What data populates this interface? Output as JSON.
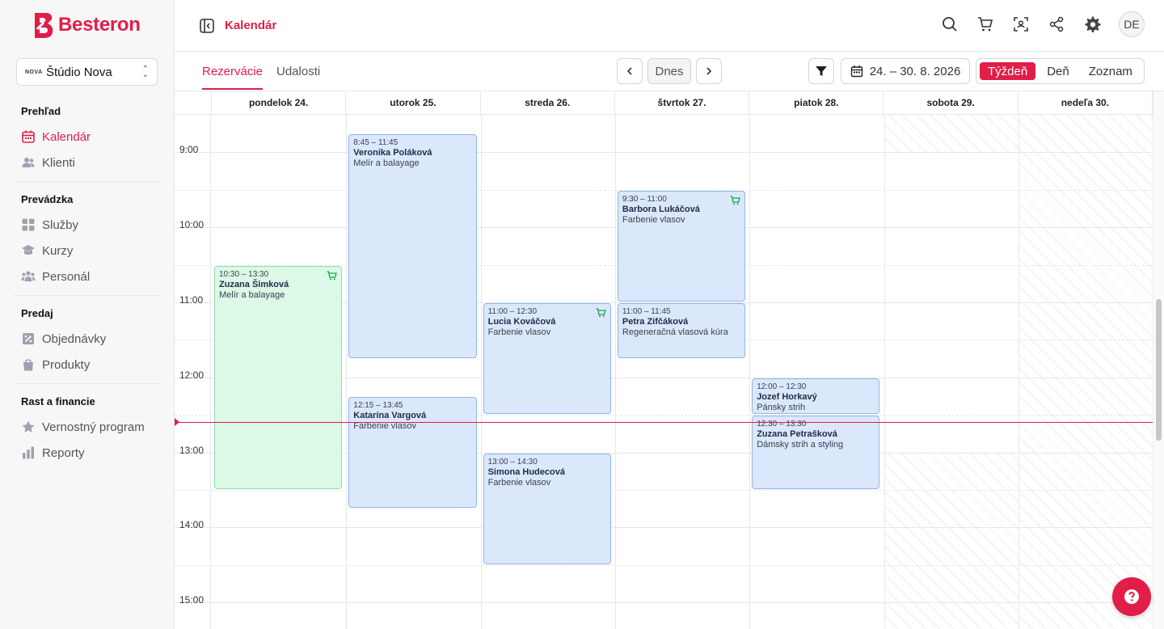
{
  "brand": {
    "name": "Besteron",
    "color": "#e11d48"
  },
  "studio": {
    "logo_text": "NOVA",
    "name": "Štúdio Nova"
  },
  "nav": {
    "groups": [
      {
        "title": "Prehľad",
        "items": [
          {
            "label": "Kalendár",
            "icon": "calendar-icon",
            "active": true
          },
          {
            "label": "Klienti",
            "icon": "users-icon"
          }
        ]
      },
      {
        "title": "Prevádzka",
        "items": [
          {
            "label": "Služby",
            "icon": "grid-icon"
          },
          {
            "label": "Kurzy",
            "icon": "graduation-cap-icon"
          },
          {
            "label": "Personál",
            "icon": "team-icon"
          }
        ]
      },
      {
        "title": "Predaj",
        "items": [
          {
            "label": "Objednávky",
            "icon": "percent-icon"
          },
          {
            "label": "Produkty",
            "icon": "bag-icon"
          }
        ]
      },
      {
        "title": "Rast a financie",
        "items": [
          {
            "label": "Vernostný program",
            "icon": "star-icon"
          },
          {
            "label": "Reporty",
            "icon": "bar-chart-icon"
          }
        ]
      }
    ]
  },
  "header": {
    "title": "Kalendár",
    "avatar": "DE"
  },
  "toolbar": {
    "tabs": [
      {
        "label": "Rezervácie",
        "active": true
      },
      {
        "label": "Udalosti"
      }
    ],
    "today_label": "Dnes",
    "date_range": "24. – 30. 8. 2026",
    "views": [
      {
        "label": "Týždeň",
        "active": true
      },
      {
        "label": "Deň"
      },
      {
        "label": "Zoznam"
      }
    ]
  },
  "calendar": {
    "days": [
      "pondelok 24.",
      "utorok 25.",
      "streda 26.",
      "štvrtok 27.",
      "piatok 28.",
      "sobota 29.",
      "nedeľa 30."
    ],
    "hours": [
      "9:00",
      "10:00",
      "11:00",
      "12:00",
      "13:00",
      "14:00",
      "15:00"
    ],
    "now_time": "12:36",
    "events": [
      {
        "day": 0,
        "start": "10:30",
        "end": "13:30",
        "time": "10:30 – 13:30",
        "name": "Zuzana Šimková",
        "service": "Melír a balayage",
        "color": "green",
        "cart": true
      },
      {
        "day": 1,
        "start": "8:45",
        "end": "11:45",
        "time": "8:45 – 11:45",
        "name": "Veronika Poláková",
        "service": "Melír a balayage",
        "color": "blue",
        "cart": false
      },
      {
        "day": 1,
        "start": "12:15",
        "end": "13:45",
        "time": "12:15 – 13:45",
        "name": "Katarína Vargová",
        "service": "Farbenie vlasov",
        "color": "blue",
        "cart": false
      },
      {
        "day": 2,
        "start": "11:00",
        "end": "12:30",
        "time": "11:00 – 12:30",
        "name": "Lucia Kováčová",
        "service": "Farbenie vlasov",
        "color": "blue",
        "cart": true
      },
      {
        "day": 2,
        "start": "13:00",
        "end": "14:30",
        "time": "13:00 – 14:30",
        "name": "Simona Hudecová",
        "service": "Farbenie vlasov",
        "color": "blue",
        "cart": false
      },
      {
        "day": 3,
        "start": "9:30",
        "end": "11:00",
        "time": "9:30 – 11:00",
        "name": "Barbora Lukáčová",
        "service": "Farbenie vlasov",
        "color": "blue",
        "cart": true
      },
      {
        "day": 3,
        "start": "11:00",
        "end": "11:45",
        "time": "11:00 – 11:45",
        "name": "Petra Zifčáková",
        "service": "Regeneračná vlasová kúra",
        "color": "blue",
        "cart": false
      },
      {
        "day": 4,
        "start": "12:00",
        "end": "12:30",
        "time": "12:00 – 12:30",
        "name": "Jozef Horkavý",
        "service": "Pánsky strih",
        "color": "blue",
        "cart": false
      },
      {
        "day": 4,
        "start": "12:30",
        "end": "13:30",
        "time": "12:30 – 13:30",
        "name": "Zuzana Petrašková",
        "service": "Dámsky strih a styling",
        "color": "blue",
        "cart": false
      }
    ]
  }
}
